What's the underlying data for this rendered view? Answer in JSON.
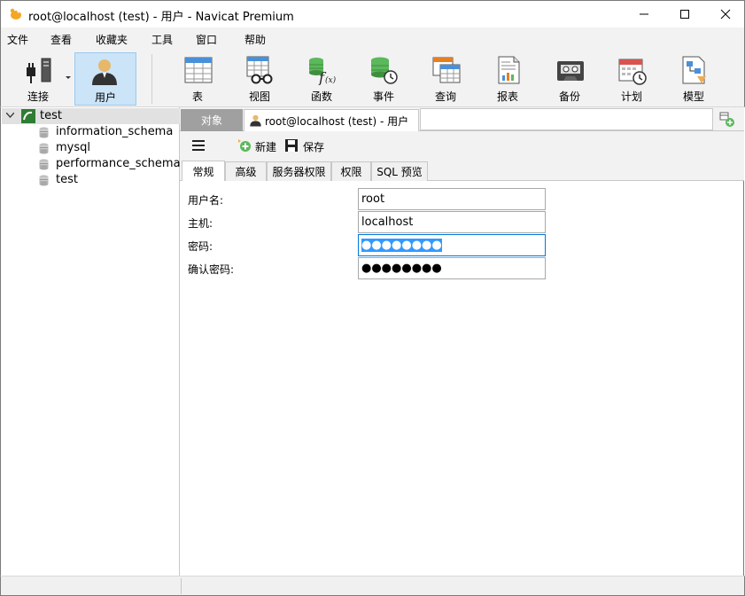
{
  "window": {
    "title": "root@localhost (test) - 用户 - Navicat Premium"
  },
  "menu": [
    "文件",
    "查看",
    "收藏夹",
    "工具",
    "窗口",
    "帮助"
  ],
  "toolbar": {
    "connect": "连接",
    "user": "用户",
    "table": "表",
    "view": "视图",
    "function": "函数",
    "event": "事件",
    "query": "查询",
    "report": "报表",
    "backup": "备份",
    "schedule": "计划",
    "model": "模型"
  },
  "tree": {
    "root": "test",
    "databases": [
      "information_schema",
      "mysql",
      "performance_schema",
      "test"
    ]
  },
  "tabs": {
    "objects": "对象",
    "user_tab": "root@localhost (test) - 用户"
  },
  "actions": {
    "new": "新建",
    "save": "保存"
  },
  "inner_tabs": [
    "常规",
    "高级",
    "服务器权限",
    "权限",
    "SQL 预览"
  ],
  "form": {
    "username_label": "用户名:",
    "username_value": "root",
    "host_label": "主机:",
    "host_value": "localhost",
    "password_label": "密码:",
    "password_value": "●●●●●●●●",
    "confirm_label": "确认密码:",
    "confirm_value": "●●●●●●●●"
  },
  "colors": {
    "accent": "#0078d7",
    "selection": "#3399ff",
    "active_toolbar": "#cce4f7"
  }
}
